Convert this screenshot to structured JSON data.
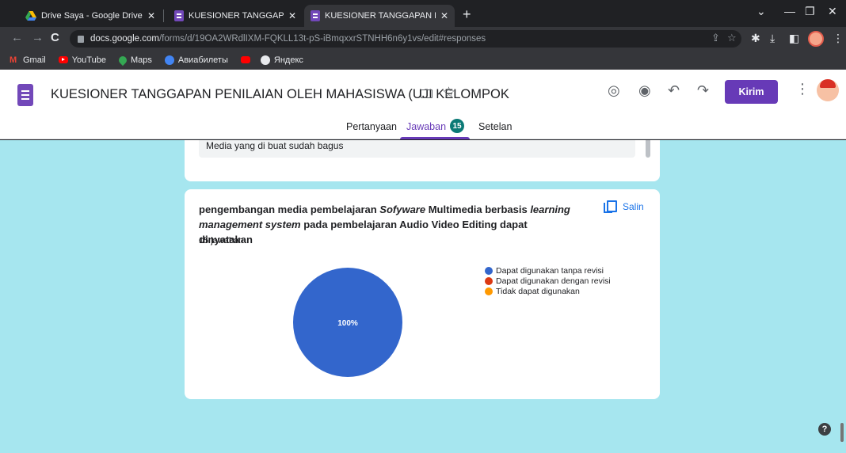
{
  "browser": {
    "tabs": [
      {
        "title": "Drive Saya - Google Drive",
        "icon": "google-drive-icon"
      },
      {
        "title": "KUESIONER TANGGAPAN PENILA",
        "icon": "google-forms-icon"
      },
      {
        "title": "KUESIONER TANGGAPAN PENILA",
        "icon": "google-forms-icon"
      }
    ],
    "url_host": "docs.google.com",
    "url_path": "/forms/d/19OA2WRdlIXM-FQKLL13t-pS-iBmqxxrSTNHH6n6y1vs/edit#responses",
    "bookmarks": [
      "Gmail",
      "YouTube",
      "Maps",
      "Авиабилеты",
      "Яндекс"
    ]
  },
  "form": {
    "title": "KUESIONER TANGGAPAN PENILAIAN OLEH MAHASISWA (UJI KELOMPOK",
    "send_label": "Kirim",
    "tabs": {
      "questions": "Pertanyaan",
      "responses": "Jawaban",
      "responses_count": "15",
      "settings": "Setelan"
    },
    "accent": "#673ab7"
  },
  "prev_answer": {
    "text": "Media yang di buat sudah bagus"
  },
  "question": {
    "title_parts": [
      {
        "text": "pengembangan media pembelajaran ",
        "italic": false
      },
      {
        "text": "Sofyware",
        "italic": true
      },
      {
        "text": " Multimedia berbasis ",
        "italic": false
      },
      {
        "text": "learning management system",
        "italic": true
      },
      {
        "text": " pada pembelajaran Audio Video Editing dapat dinyatakan",
        "italic": false
      }
    ],
    "response_count_label": "15 jawaban",
    "copy_label": "Salin"
  },
  "chart_data": {
    "type": "pie",
    "slices": [
      {
        "label": "Dapat digunakan tanpa revisi",
        "value": 100,
        "color": "#3366cc"
      },
      {
        "label": "Dapat digunakan dengan revisi",
        "value": 0,
        "color": "#dc3912"
      },
      {
        "label": "Tidak dapat digunakan",
        "value": 0,
        "color": "#ff9900"
      }
    ],
    "data_labels": [
      "100%"
    ],
    "legend_position": "right"
  }
}
